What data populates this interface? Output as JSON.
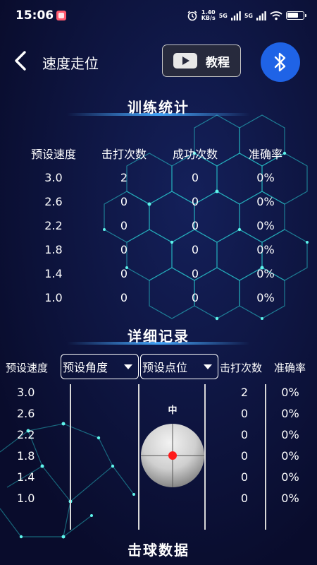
{
  "status_bar": {
    "time": "15:06",
    "net_speed_value": "1.40",
    "net_speed_unit": "KB/s",
    "network_1": "5G",
    "network_2": "5G"
  },
  "header": {
    "title": "速度走位",
    "tutorial_label": "教程",
    "icons": [
      "back-arrow-icon",
      "play-icon",
      "bluetooth-icon"
    ],
    "bluetooth_color": "#1f63e6"
  },
  "training_stats": {
    "title": "训练统计",
    "columns": [
      "预设速度",
      "击打次数",
      "成功次数",
      "准确率"
    ],
    "rows": [
      [
        "3.0",
        "2",
        "0",
        "0%"
      ],
      [
        "2.6",
        "0",
        "0",
        "0%"
      ],
      [
        "2.2",
        "0",
        "0",
        "0%"
      ],
      [
        "1.8",
        "0",
        "0",
        "0%"
      ],
      [
        "1.4",
        "0",
        "0",
        "0%"
      ],
      [
        "1.0",
        "0",
        "0",
        "0%"
      ]
    ]
  },
  "detail_records": {
    "title": "详细记录",
    "speed_header": "预设速度",
    "angle_dropdown": "预设角度",
    "point_dropdown": "预设点位",
    "hits_header": "击打次数",
    "accuracy_header": "准确率",
    "zone_label": "中",
    "speeds": [
      "3.0",
      "2.6",
      "2.2",
      "1.8",
      "1.4",
      "1.0"
    ],
    "hits": [
      "2",
      "0",
      "0",
      "0",
      "0",
      "0"
    ],
    "accuracy": [
      "0%",
      "0%",
      "0%",
      "0%",
      "0%",
      "0%"
    ],
    "target_color": "#ff1a1a"
  },
  "hit_data": {
    "title": "击球数据"
  },
  "colors": {
    "background": "#0b0f33",
    "accent_glow": "#2ee6e0"
  }
}
